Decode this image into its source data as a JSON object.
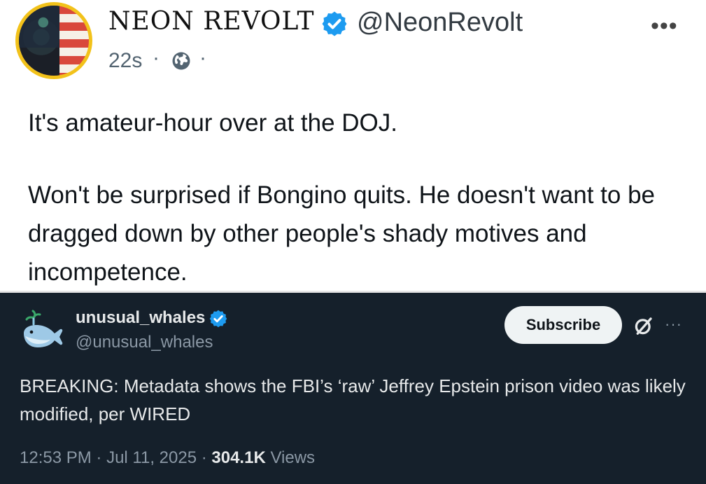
{
  "post": {
    "display_name": "NEON REVOLT",
    "handle": "@NeonRevolt",
    "time": "22s",
    "separator": "·",
    "more": "•••",
    "body": [
      "It's amateur-hour over at the DOJ.",
      "Won't be surprised if Bongino quits. He doesn't want to be dragged down by other people's shady motives and incompetence."
    ]
  },
  "quoted": {
    "display_name": "unusual_whales",
    "handle": "@unusual_whales",
    "subscribe_label": "Subscribe",
    "more": "···",
    "text": "BREAKING: Metadata shows the FBI’s ‘raw’ Jeffrey Epstein prison video was likely modified, per WIRED",
    "time": "12:53 PM",
    "date": "Jul 11, 2025",
    "separator": " · ",
    "views_count": "304.1K",
    "views_label": " Views"
  },
  "colors": {
    "verified": "#1d9bf0",
    "embed_bg": "#15202b",
    "avatar_ring": "#f2c21a"
  },
  "icons": [
    "verified-badge-icon",
    "globe-icon",
    "more-icon",
    "whale-icon",
    "grok-icon"
  ]
}
